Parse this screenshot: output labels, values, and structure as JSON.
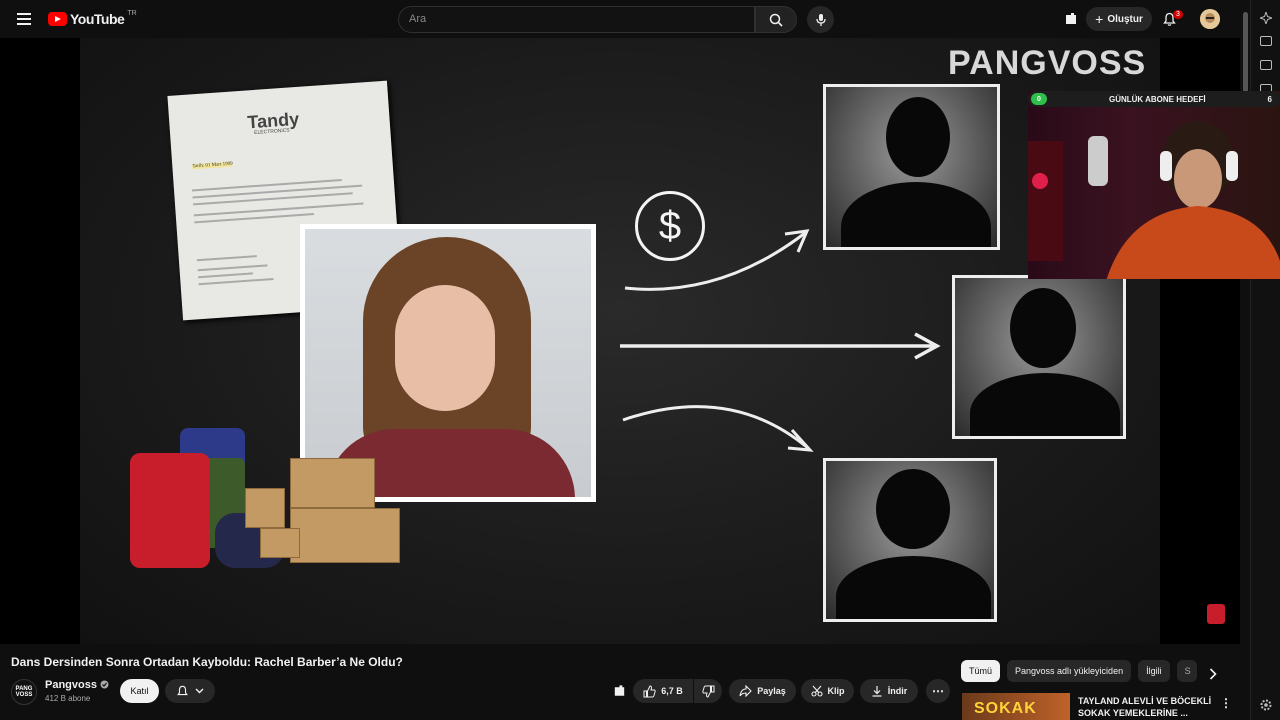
{
  "header": {
    "logo_text": "YouTube",
    "logo_region": "TR",
    "search_placeholder": "Ara",
    "create_label": "Oluştur",
    "notification_count": "3"
  },
  "video": {
    "watermark": "PANGVOSS",
    "letter_brand": "Tandy",
    "letter_brand_sub": "ELECTRONICS",
    "letter_highlight": "Tarih: 01 Mart 1999",
    "overlay_goal_label": "GÜNLÜK ABONE HEDEFİ",
    "overlay_goal_current": "0",
    "overlay_goal_target": "6",
    "dollar_symbol": "$"
  },
  "meta": {
    "title": "Dans Dersinden Sonra Ortadan Kayboldu: Rachel Barber’a Ne Oldu?",
    "channel_name": "Pangvoss",
    "channel_avatar_text": "PANG VOSS",
    "subscribers": "412 B abone",
    "join_label": "Katıl",
    "like_count": "6,7 B",
    "share_label": "Paylaş",
    "clip_label": "Klip",
    "download_label": "İndir"
  },
  "chips": [
    {
      "label": "Tümü"
    },
    {
      "label": "Pangvoss adlı yükleyiciden"
    },
    {
      "label": "İlgili"
    },
    {
      "label": "S"
    }
  ],
  "recommendation": {
    "title": "TAYLAND ALEVLİ VE BÖCEKLİ SOKAK YEMEKLERİNE ...",
    "thumb_text": "SOKAK"
  },
  "colors": {
    "accent": "#ff0000",
    "background": "#0f0f0f",
    "surface": "#272727",
    "goal_green": "#2fbf4a"
  }
}
